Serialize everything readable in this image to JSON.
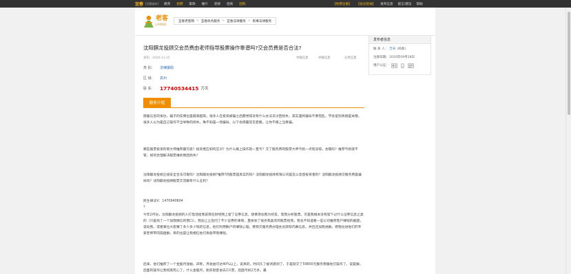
{
  "topbar": {
    "city": "宜春",
    "switch_city": "[切换城市]",
    "nav": [
      "教育",
      "招聘",
      "家政",
      "婚介",
      "装修",
      "招商",
      "团购"
    ],
    "right_links": [
      "【免费注册】",
      "【会员登录】",
      "发布信息",
      "留言/建议",
      "帮助"
    ]
  },
  "logo": {
    "name": "老客",
    "sub": "LAOKE"
  },
  "breadcrumb": [
    "宜春老客网",
    "宜春商务服务",
    "宜春法律服务",
    "刑事法律服务"
  ],
  "post": {
    "title": "沈阳麒龙投顾交会员费由老师指导股票操作靠谱吗?交会员费是否合法?",
    "date": "发布：2020-11-25",
    "actions": [
      "举报信息",
      "举报信息",
      "分享信息"
    ],
    "fields": [
      {
        "key": "类    别:",
        "value": "法律援助"
      },
      {
        "key": "区    域:",
        "value": "袁州"
      },
      {
        "key": "联    系:",
        "value": "17740534415",
        "unit": "万天"
      }
    ],
    "section_title": "服务介绍",
    "paragraphs": [
      "随着信息的发达，骗子的伎俩也是越来越高，很多人在投资被骗之后都觉得没有什么办法去讨回损失，其实遇到骗局不要慌乱，学会鉴别真假是关键。很多人以为是自己操作不当导致的损失，殊不知是一场骗局，以下会揭露常见套路，让你不再上当受骗。",
      "哪些股票投资的假大师推荐最可恶？投资者应如何应对？为什么跟上操作就一直亏？交了服务费的股票大师亏损一点钱没得，会赔吗？推荐亏损就不管，如何合理解决股票维权挽回损失？",
      "沈阳麒龙投顾正规安全合法可靠吗？沈阳麒龙投顾?推荐?的股票是真实的吗？沈阳麒龙投顾有限公司是怎么忽悠投资者的？沈阳麒龙投顾交服务费是骗局吗？沈阳麒龙投顾股票交流群有什么五机？",
      "民生律法V：1470940604\n?",
      "今年2月份，沈阳麒龙投顾的人打电话给我说我在财经网上留了证券信息，想要添加我为好友，帮我分析股票。可是我根本没有留下过什么证券信息之类的（只是找了一个加我微信的借口）。我加上之后问了不少证券的事情，直接发了很多我喜欢的股票给我，我也不知道看一些公司推荐客户赚钱的截图，说动我，或者某位大客赚了多少多少钱的信息，他们利用散户的赚钱心理，要我交服务费办理会员获取内幕信息，并且还加我进群，把我拉进他们的专家老师带的操盘群，目的也是让我相信他们真能带我赚钱。",
      "后来，他们推荐了一个金股月涨幅，声称，月收益可达40%以上，说真的，时间久了被诱惑到了，于是就交了59800元服务费跟他们操作了，说是跟，后面的操作让我彻底死心了，什么金股月，刚买就套进去2只票，后面亏损2万多，最"
    ]
  },
  "publisher": {
    "heading": "发布者信息",
    "name_label": "联  系 人：",
    "name": "万天",
    "name_note": "(商家)",
    "date_label": "注册日期：",
    "date": "2020年09月28日",
    "cert_label": "用户认证："
  },
  "colors": {
    "accent": "#f08d00",
    "link": "#2d6bb5",
    "phone": "#dd0000",
    "topbar": "#333333"
  },
  "icons": [
    "logo-mark-icon",
    "id-card-icon",
    "phone-verified-icon",
    "business-license-icon"
  ]
}
